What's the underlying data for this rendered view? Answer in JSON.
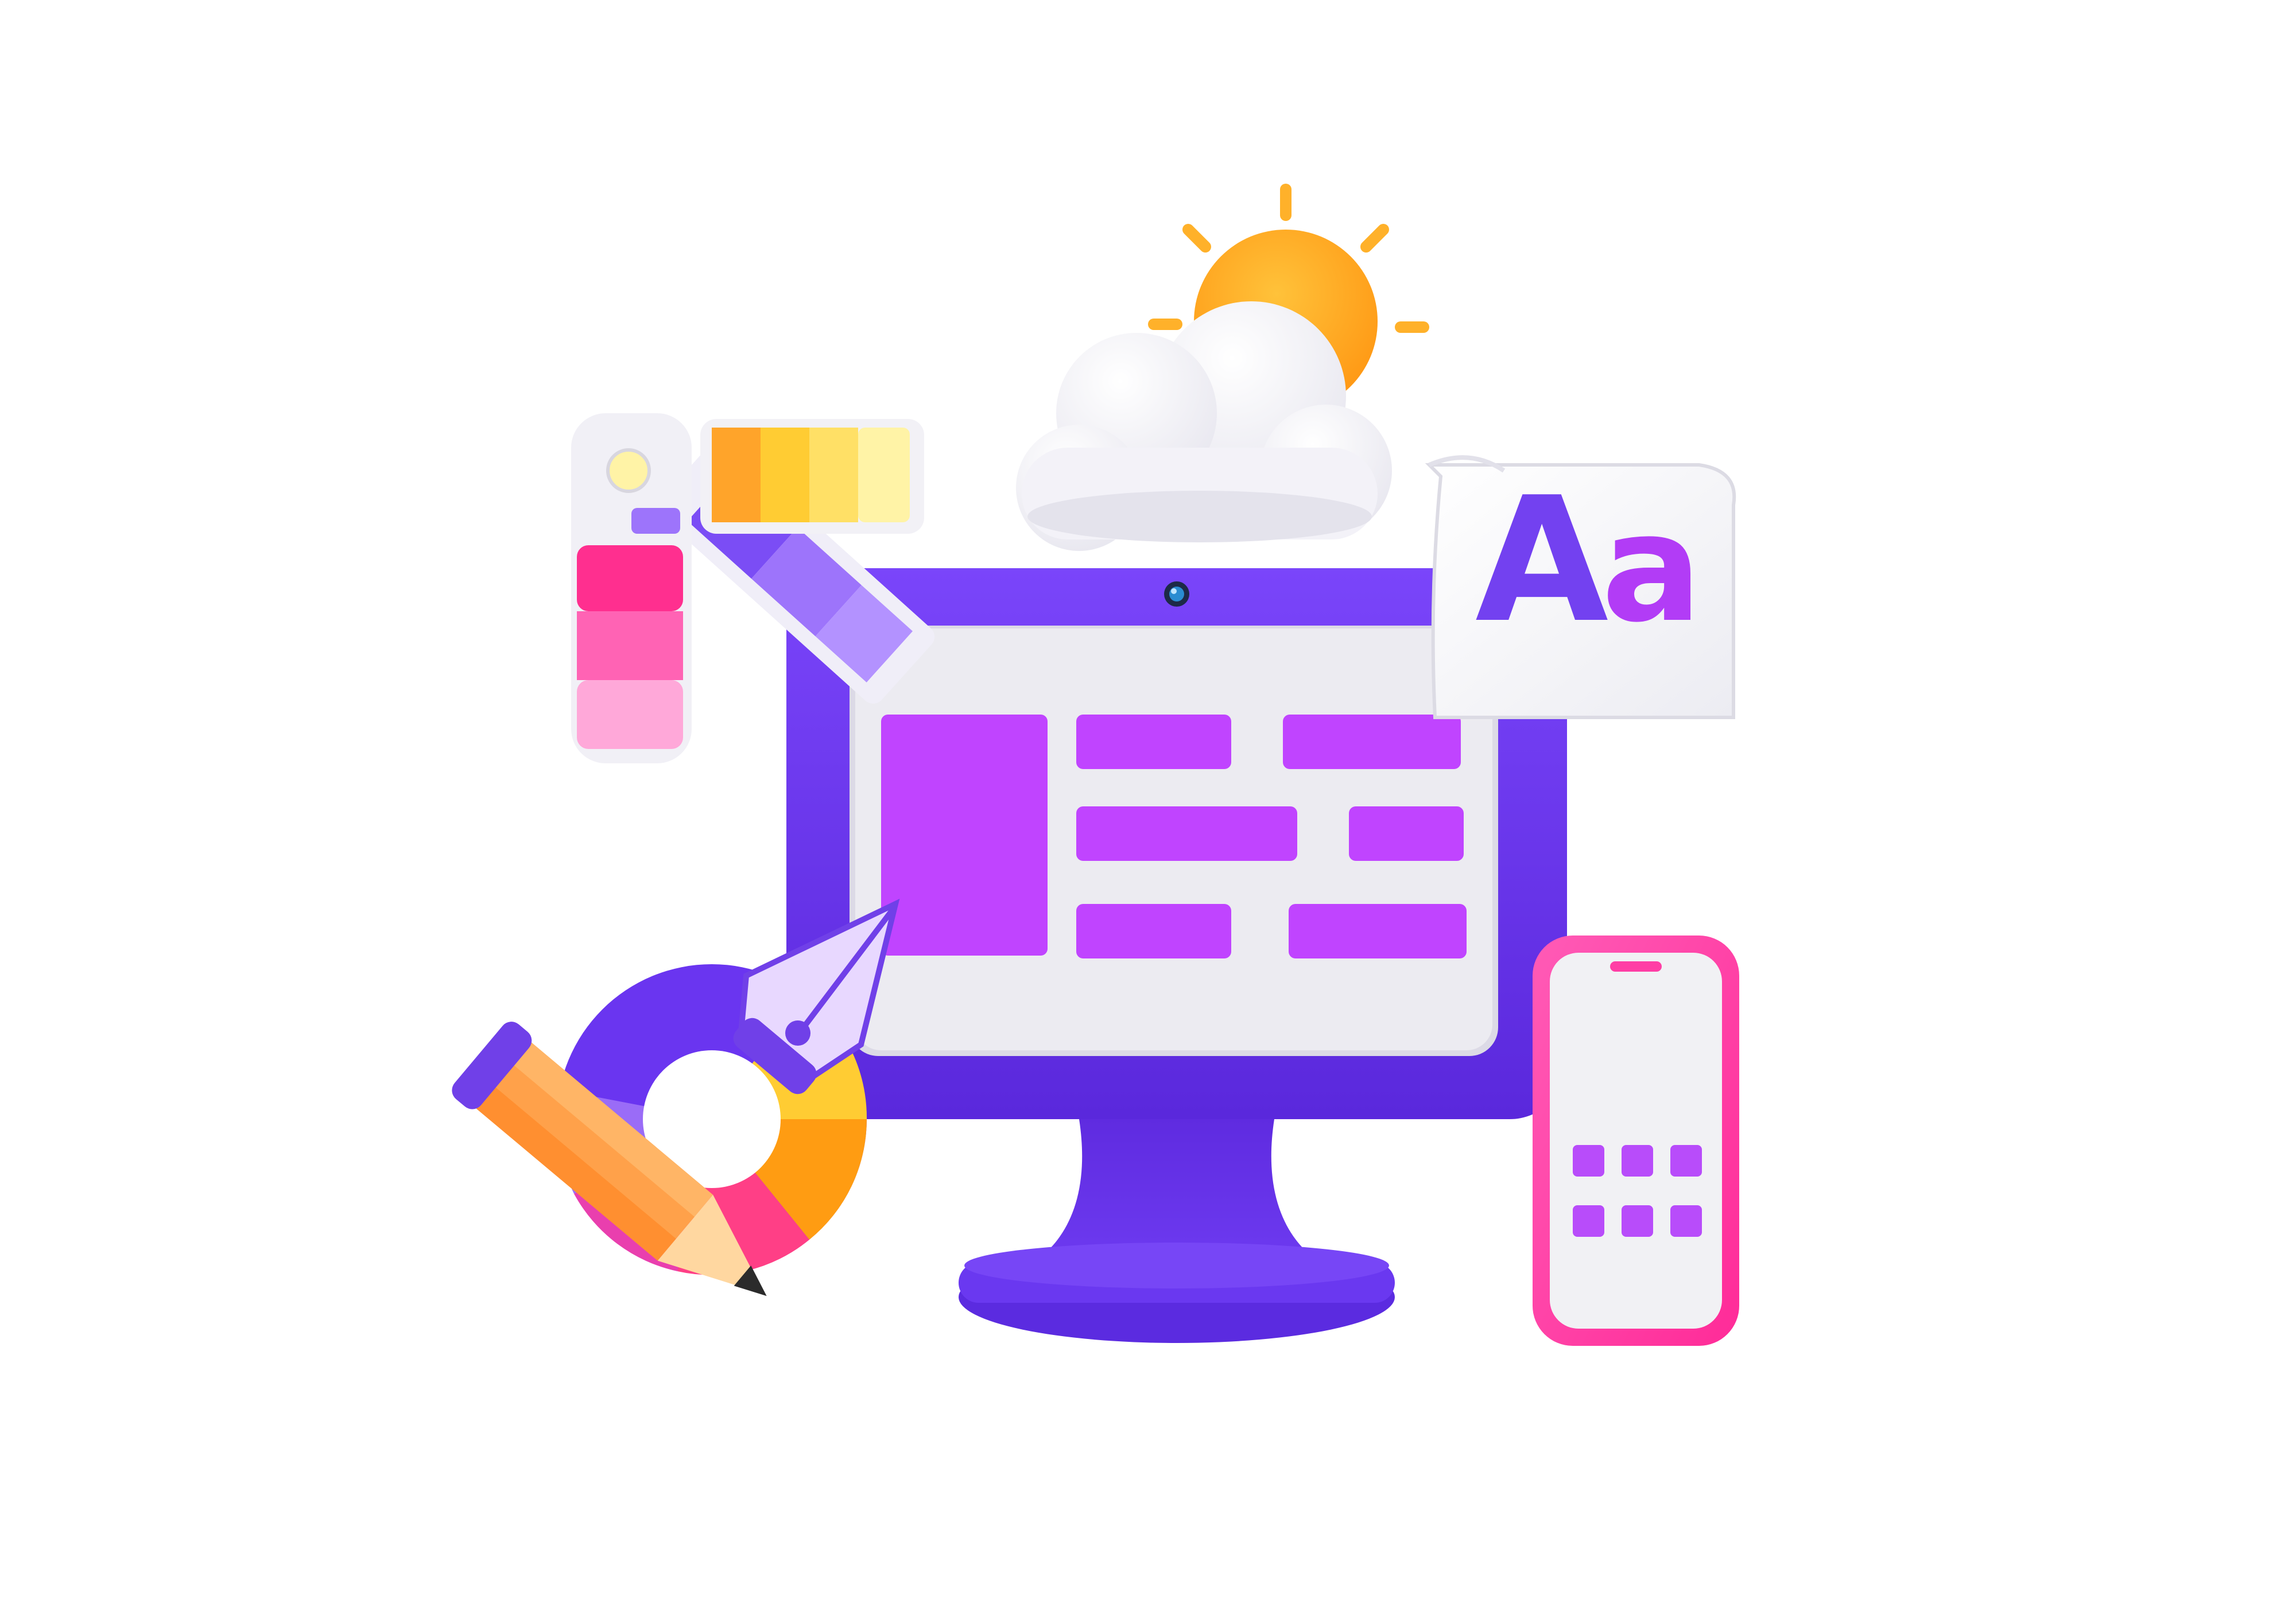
{
  "scene": {
    "description_free": true,
    "typography_card": {
      "upper": "A",
      "lower": "a"
    },
    "phone_grid": {
      "rows": 2,
      "cols": 3
    }
  },
  "colors": {
    "background": "#ffffff",
    "monitor_body": "#6a35f0",
    "monitor_dark": "#4b23c9",
    "screen_bg": "#ecebf1",
    "screen_blocks": "#c044ff",
    "phone_frame": "#ff3ea5",
    "phone_screen": "#f1f1f4",
    "phone_icons": "#b84cfa",
    "sun": "#ffa11f",
    "sun_rays": "#ffb62e",
    "cloud": "#f7f7fa",
    "aa_upper": "#7341f0",
    "aa_lower": "#b23cf6",
    "swatch_yellow": [
      "#ffa42a",
      "#ffcc33",
      "#ffe066",
      "#fff3a6"
    ],
    "swatch_pink": [
      "#ff2f8f",
      "#ff63b4",
      "#ffa8d9"
    ],
    "swatch_purple": [
      "#7b4df5",
      "#9d74fb"
    ],
    "wheel": [
      "#6a35f0",
      "#9a6cf7",
      "#ff3f86",
      "#ff9c12",
      "#ffcc33",
      "#e93fae"
    ],
    "pencil_body": "#ffa14a",
    "pencil_tip": "#ffd7a0",
    "pencil_lead": "#2b2b2b",
    "pen_nib": "#e8d8ff",
    "pen_dark": "#7040e8"
  },
  "icons": [
    "monitor-icon",
    "smartphone-icon",
    "sun-icon",
    "cloud-icon",
    "typography-icon",
    "color-swatches-icon",
    "color-wheel-icon",
    "pencil-icon",
    "pen-nib-icon",
    "webcam-icon"
  ]
}
